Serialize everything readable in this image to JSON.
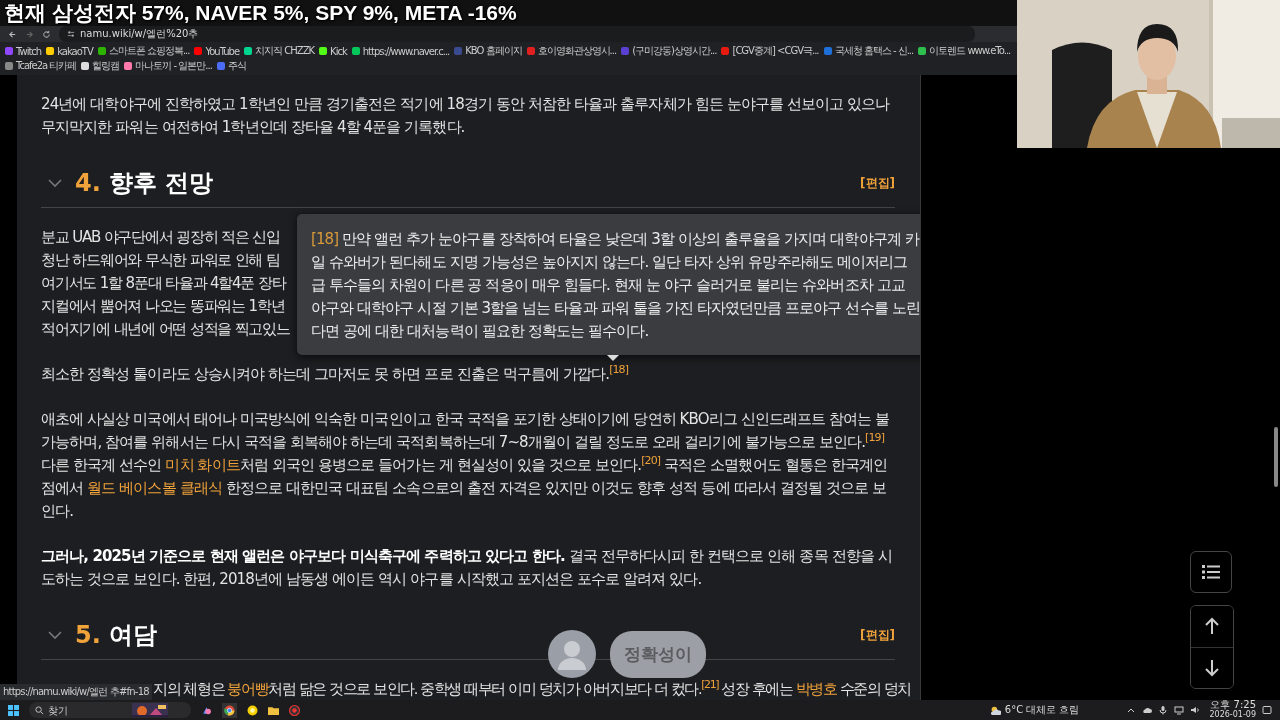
{
  "overlay_title": "현재 삼성전자 57%, NAVER 5%, SPY 9%, META -16%",
  "address_bar": {
    "url": "namu.wiki/w/엘런%20추"
  },
  "bookmarks": [
    {
      "label": "Twitch",
      "color": "#9146ff"
    },
    {
      "label": "kakaoTV",
      "color": "#ffcd00"
    },
    {
      "label": "스마트폰 쇼핑정복...",
      "color": "#2db400"
    },
    {
      "label": "YouTube",
      "color": "#ff0000"
    },
    {
      "label": "치지직 CHZZK",
      "color": "#00d68f"
    },
    {
      "label": "Kick",
      "color": "#53fc18"
    },
    {
      "label": "https://www.naver.c...",
      "color": "#03c75a"
    },
    {
      "label": "KBO 홈페이지",
      "color": "#3a4a8e"
    },
    {
      "label": "호이영화관상영시...",
      "color": "#e02020"
    },
    {
      "label": "(구미강동)상영시간...",
      "color": "#5a3fd0"
    },
    {
      "label": "[CGV중계] <CGV극...",
      "color": "#e71a0f"
    },
    {
      "label": "국세청 홈택스 - 신...",
      "color": "#1e6fd9"
    },
    {
      "label": "이토렌드 www.eTo...",
      "color": "#2fbf4f"
    },
    {
      "label": "Tcafe2a 티카페",
      "color": "#888888"
    },
    {
      "label": "힐링캠",
      "color": "#dddddd"
    },
    {
      "label": "마나토끼 - 일본만...",
      "color": "#ff7aa8"
    },
    {
      "label": "주식",
      "color": "#4a6cf7"
    }
  ],
  "article": {
    "blocks": [
      {
        "kind": "paragraph",
        "segments": [
          {
            "kind": "text",
            "text": "24년에 대학야구에 진학하였고 1학년인 만큼 경기출전은 적기에 18경기 동안 처참한 타율과 출루자체가 힘든 눈야구를 선보이고 있으나 무지막지한 파워는 여전하여 1학년인데 장타율 4할 4푼을 기록했다."
          }
        ]
      },
      {
        "kind": "heading",
        "number": "4.",
        "title": "향후 전망",
        "edit": "[편집]",
        "expanded": true
      },
      {
        "kind": "cut_lines",
        "lines": [
          "분교 UAB 야구단에서 굉장히 적은 신입",
          "청난 하드웨어와 무식한 파워로 인해 팀",
          "여기서도 1할 8푼대 타율과 4할4푼 장타",
          "지컬에서 뿜어져 나오는 똥파워는 1학년",
          "적어지기에 내년에 어떤 성적을 찍고있느"
        ]
      },
      {
        "kind": "paragraph",
        "segments": [
          {
            "kind": "text",
            "text": "최소한 정확성 툴이라도 상승시켜야 하는데 그마저도 못 하면 프로 진출은 먹구름에 가깝다."
          },
          {
            "kind": "footnote",
            "text": "[18]"
          }
        ]
      },
      {
        "kind": "paragraph",
        "segments": [
          {
            "kind": "text",
            "text": "애초에 사실상 미국에서 태어나 미국방식에 익숙한 미국인이고 한국 국적을 포기한 상태이기에 당연히 KBO리그 신인드래프트 참여는 불가능하며, 참여를 위해서는 다시 국적을 회복해야 하는데 국적회복하는데 7~8개월이 걸릴 정도로 오래 걸리기에 불가능으로 보인다."
          },
          {
            "kind": "footnote",
            "text": "[19]"
          },
          {
            "kind": "text",
            "text": " 다른 한국계 선수인 "
          },
          {
            "kind": "link",
            "text": "미치 화이트"
          },
          {
            "kind": "text",
            "text": "처럼 외국인 용병으로 들어가는 게 현실성이 있을 것으로 보인다."
          },
          {
            "kind": "footnote",
            "text": "[20]"
          },
          {
            "kind": "text",
            "text": " 국적은 소멸했어도 혈통은 한국계인 점에서 "
          },
          {
            "kind": "link",
            "text": "월드 베이스볼 클래식"
          },
          {
            "kind": "text",
            "text": " 한정으로 대한민국 대표팀 소속으로의 출전 자격은 있지만 이것도 향후 성적 등에 따라서 결정될 것으로 보인다."
          }
        ]
      },
      {
        "kind": "paragraph",
        "segments": [
          {
            "kind": "bold",
            "text": "그러나, 2025년 기준으로 현재 앨런은 야구보다 미식축구에 주력하고 있다고 한다."
          },
          {
            "kind": "text",
            "text": " 결국 전무하다시피 한 컨택으로 인해 종목 전향을 시도하는 것으로 보인다. 한편, 2018년에 남동생 에이든 역시 야구를 시작했고 포지션은 포수로 알려져 있다."
          }
        ]
      },
      {
        "kind": "heading",
        "number": "5.",
        "title": "여담",
        "edit": "[편집]",
        "expanded": true
      },
      {
        "kind": "cut_paragraph",
        "segments": [
          {
            "kind": "text",
            "text": "지의 체형은 "
          },
          {
            "kind": "link",
            "text": "붕어빵"
          },
          {
            "kind": "text",
            "text": "처럼 닮은 것으로 보인다. 중학생 때부터 이미 덩치가 아버지보다 더 컸다."
          },
          {
            "kind": "footnote",
            "text": "[21]"
          },
          {
            "kind": "text",
            "text": " 성장 후에는 "
          },
          {
            "kind": "link",
            "text": "박병호"
          },
          {
            "kind": "text",
            "text": " 수준의 덩치"
          }
        ]
      }
    ]
  },
  "tooltip": {
    "ref": "[18]",
    "text": "만약 앨런 추가 눈야구를 장착하여 타율은 낮은데 3할 이상의 출루율을 가지며 대학야구계 카일 슈와버가 된다해도 지명 가능성은 높아지지 않는다. 일단 타자 상위 유망주라해도 메이저리그급 투수들의 차원이 다른 공 적응이 매우 힘들다. 현재 눈 야구 슬러거로 불리는 슈와버조차 고교 야구와 대학야구 시절 기본 3할을 넘는 타율과 파워 툴을 가진 타자였던만큼 프로야구 선수를 노린다면 공에 대한 대처능력이 필요한 정확도는 필수이다."
  },
  "status_url": "https://namu.wiki/w/엘런 추#fn-18",
  "chat_overlay": {
    "text": "정확성이"
  },
  "taskbar": {
    "search_placeholder": "찾기",
    "weather": "6°C 대체로 흐림",
    "time": "오후 7:25",
    "date": "2026-01-09"
  }
}
